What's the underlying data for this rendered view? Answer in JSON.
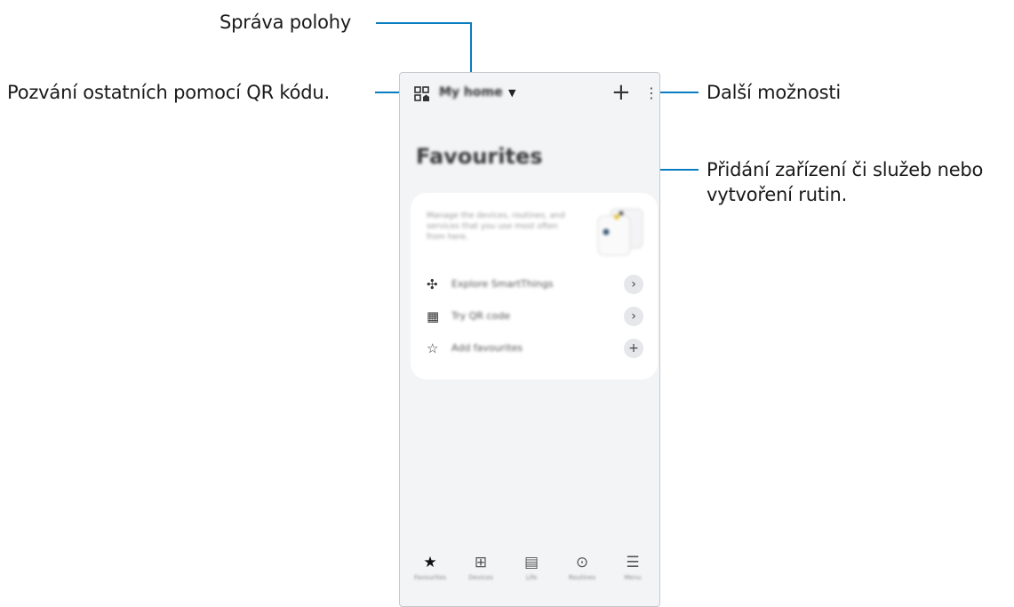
{
  "callouts": {
    "location": "Správa polohy",
    "invite": "Pozvání ostatních pomocí QR kódu.",
    "more": "Další možnosti",
    "add_line1": "Přidání zařízení či služeb nebo",
    "add_line2": "vytvoření rutin."
  },
  "app": {
    "home_name": "My home",
    "title": "Favourites",
    "card_description": "Manage the devices, routines, and services that you use most often from here.",
    "rows": [
      {
        "label": "Explore SmartThings",
        "icon": "fan-icon",
        "glyph": "✣",
        "action": "›"
      },
      {
        "label": "Try QR code",
        "icon": "qr-code-icon",
        "glyph": "▦",
        "action": "›"
      },
      {
        "label": "Add favourites",
        "icon": "star-outline-icon",
        "glyph": "☆",
        "action": "+"
      }
    ],
    "nav": [
      {
        "label": "Favourites",
        "icon": "star-icon",
        "glyph": "★"
      },
      {
        "label": "Devices",
        "icon": "devices-icon",
        "glyph": "⊞"
      },
      {
        "label": "Life",
        "icon": "life-icon",
        "glyph": "▤"
      },
      {
        "label": "Routines",
        "icon": "routines-icon",
        "glyph": "⊙"
      },
      {
        "label": "Menu",
        "icon": "menu-icon",
        "glyph": "☰"
      }
    ]
  },
  "colors": {
    "callout_line": "#0a7cc0",
    "phone_bg": "#f3f4f6"
  }
}
